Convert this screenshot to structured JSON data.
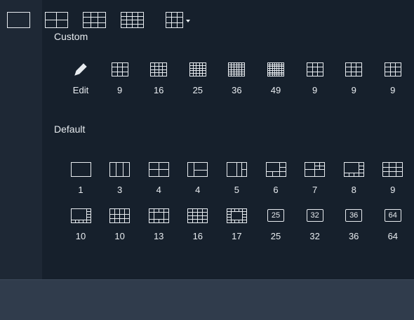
{
  "custom": {
    "title": "Custom",
    "items": [
      {
        "label": "Edit",
        "icon": "pencil-icon"
      },
      {
        "label": "9",
        "grid": [
          3,
          3
        ]
      },
      {
        "label": "16",
        "grid": [
          4,
          4
        ]
      },
      {
        "label": "25",
        "grid": [
          5,
          5
        ]
      },
      {
        "label": "36",
        "grid": [
          6,
          6
        ]
      },
      {
        "label": "49",
        "grid": [
          7,
          7
        ]
      },
      {
        "label": "9",
        "grid": [
          3,
          3
        ]
      },
      {
        "label": "9",
        "grid": [
          3,
          3
        ]
      },
      {
        "label": "9",
        "grid": [
          3,
          3
        ]
      }
    ]
  },
  "default": {
    "title": "Default",
    "row1": [
      {
        "label": "1",
        "layout": "single"
      },
      {
        "label": "3",
        "layout": "cols3"
      },
      {
        "label": "4",
        "layout": "quad"
      },
      {
        "label": "4",
        "layout": "l-shape"
      },
      {
        "label": "5",
        "layout": "big-left-5"
      },
      {
        "label": "6",
        "layout": "big-6"
      },
      {
        "label": "7",
        "layout": "seven"
      },
      {
        "label": "8",
        "layout": "big-8"
      },
      {
        "label": "9",
        "layout": "grid9"
      }
    ],
    "row2": [
      {
        "label": "10",
        "layout": "big-10"
      },
      {
        "label": "10",
        "layout": "ten-b"
      },
      {
        "label": "13",
        "layout": "ring-13"
      },
      {
        "label": "16",
        "layout": "grid16"
      },
      {
        "label": "17",
        "layout": "ring-17"
      },
      {
        "label": "25",
        "boxed": "25"
      },
      {
        "label": "32",
        "boxed": "32"
      },
      {
        "label": "36",
        "boxed": "36"
      },
      {
        "label": "64",
        "boxed": "64"
      }
    ]
  },
  "bottom_bar": {
    "buttons": [
      {
        "name": "layout-1-button",
        "layout": "single"
      },
      {
        "name": "layout-4-button",
        "layout": "quad"
      },
      {
        "name": "layout-9-button",
        "layout": "grid9"
      },
      {
        "name": "layout-16-button",
        "layout": "grid16"
      },
      {
        "name": "layout-more-dropdown",
        "layout": "grid9"
      }
    ]
  },
  "colors": {
    "icon_stroke": "#e8ecf0",
    "panel_bg": "#16202c",
    "bar_bg": "#303c4c"
  }
}
